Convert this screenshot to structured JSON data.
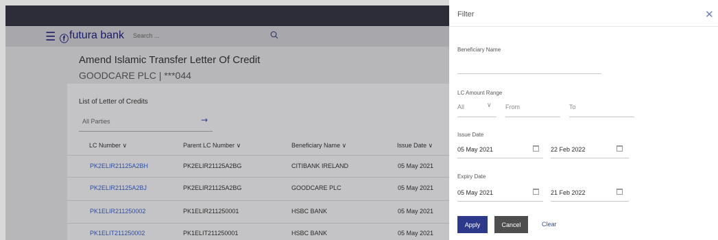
{
  "header": {
    "brand": "futura bank",
    "search_placeholder": "Search ..."
  },
  "page": {
    "title": "Amend Islamic Transfer Letter Of Credit",
    "subtitle": "GOODCARE PLC | ***044"
  },
  "list": {
    "title": "List of Letter of Credits",
    "parties_filter": "All Parties",
    "columns": [
      "LC Number",
      "Parent LC Number",
      "Beneficiary Name",
      "Issue Date"
    ],
    "rows": [
      {
        "lc_number": "PK2ELIR21125A2BH",
        "parent_lc": "PK2ELIR21125A2BG",
        "beneficiary": "CITIBANK IRELAND",
        "issue_date": "05 May 2021"
      },
      {
        "lc_number": "PK2ELIR21125A2BJ",
        "parent_lc": "PK2ELIR21125A2BG",
        "beneficiary": "GOODCARE PLC",
        "issue_date": "05 May 2021"
      },
      {
        "lc_number": "PK1ELIR211250002",
        "parent_lc": "PK1ELIR211250001",
        "beneficiary": "HSBC BANK",
        "issue_date": "05 May 2021"
      },
      {
        "lc_number": "PK1ELIT211250002",
        "parent_lc": "PK1ELIT211250001",
        "beneficiary": "HSBC BANK",
        "issue_date": "05 May 2021"
      }
    ]
  },
  "filter": {
    "title": "Filter",
    "beneficiary_label": "Beneficiary Name",
    "beneficiary_value": "",
    "amount_label": "LC Amount Range",
    "currency": "All",
    "from_placeholder": "From",
    "to_placeholder": "To",
    "issue_label": "Issue Date",
    "issue_from": "05 May 2021",
    "issue_to": "22 Feb 2022",
    "expiry_label": "Expiry Date",
    "expiry_from": "05 May 2021",
    "expiry_to": "21 Feb 2022",
    "apply": "Apply",
    "cancel": "Cancel",
    "clear": "Clear"
  },
  "colors": {
    "primary": "#2d3a8c",
    "link": "#2f4ea0",
    "cancel": "#4e4e4e"
  }
}
